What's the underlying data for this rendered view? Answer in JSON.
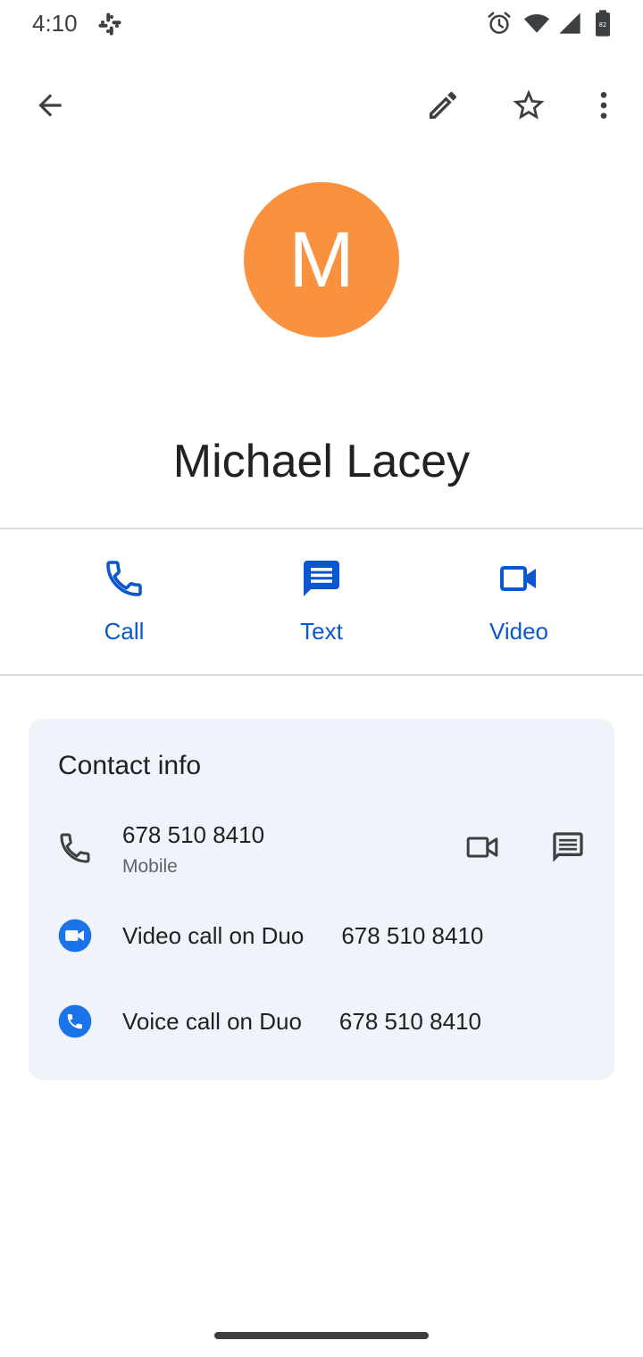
{
  "status_bar": {
    "time": "4:10",
    "icons": [
      "slack-icon",
      "alarm-icon",
      "wifi-icon",
      "signal-icon",
      "battery-icon"
    ]
  },
  "top_bar": {
    "icons": [
      "back-arrow-icon",
      "edit-pencil-icon",
      "star-outline-icon",
      "more-vert-icon"
    ]
  },
  "contact": {
    "initial": "M",
    "avatar_color": "#f9913f",
    "name": "Michael Lacey"
  },
  "actions": [
    {
      "label": "Call",
      "icon": "phone-icon"
    },
    {
      "label": "Text",
      "icon": "message-icon"
    },
    {
      "label": "Video",
      "icon": "videocam-icon"
    }
  ],
  "contact_info": {
    "title": "Contact info",
    "phone": {
      "number": "678 510 8410",
      "type": "Mobile"
    },
    "duo_video": {
      "label": "Video call on Duo",
      "number": "678 510 8410"
    },
    "duo_voice": {
      "label": "Voice call on Duo",
      "number": "678 510 8410"
    }
  },
  "colors": {
    "accent": "#0b57d0",
    "card_bg": "#eff3fa",
    "duo_blue": "#1a73e8"
  }
}
